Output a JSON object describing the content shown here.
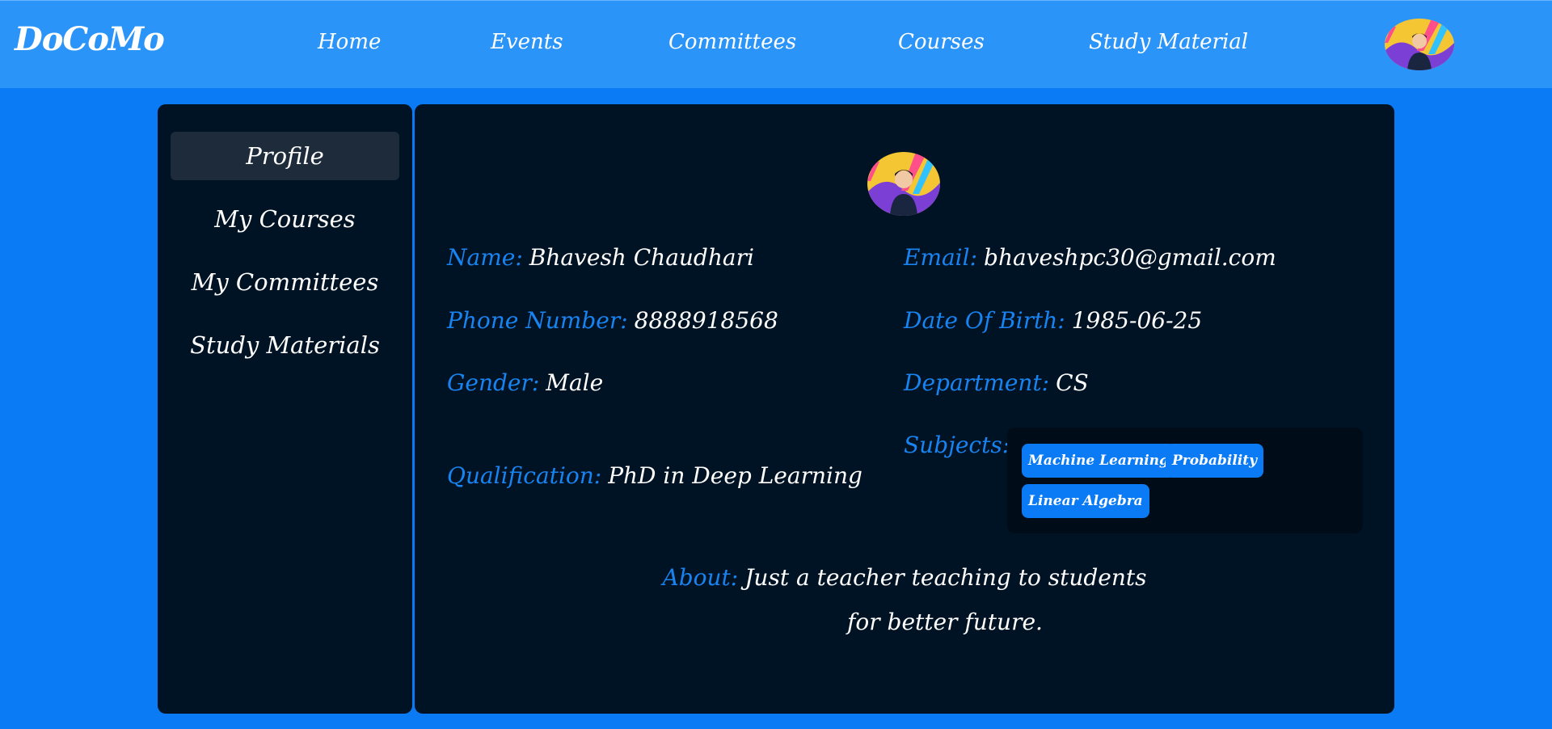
{
  "navbar": {
    "brand": "DoCoMo",
    "links": [
      "Home",
      "Events",
      "Committees",
      "Courses",
      "Study Material"
    ]
  },
  "sidebar": {
    "items": [
      "Profile",
      "My Courses",
      "My Committees",
      "Study Materials"
    ],
    "active": "Profile"
  },
  "profile": {
    "name_label": "Name:",
    "name": "Bhavesh Chaudhari",
    "email_label": "Email:",
    "email": "bhaveshpc30@gmail.com",
    "phone_label": "Phone Number:",
    "phone": "8888918568",
    "dob_label": "Date Of Birth:",
    "dob": "1985-06-25",
    "gender_label": "Gender:",
    "gender": "Male",
    "department_label": "Department:",
    "department": "CS",
    "qualification_label": "Qualification:",
    "qualification": "PhD in Deep Learning",
    "subjects_label": "Subjects:",
    "subjects": [
      "Machine Learning",
      "Probability",
      "Linear Algebra"
    ],
    "about_label": "About:",
    "about_line1": "Just a teacher teaching to students",
    "about_line2": "for better future."
  },
  "colors": {
    "page_bg": "#0a7bf5",
    "navbar_bg": "#2b94f8",
    "panel_bg": "#001324",
    "label_blue": "#1784f2",
    "chip_bg": "#0a7bf5"
  },
  "icons": {
    "nav_avatar": "user-avatar-icon",
    "profile_avatar": "user-avatar-icon"
  }
}
